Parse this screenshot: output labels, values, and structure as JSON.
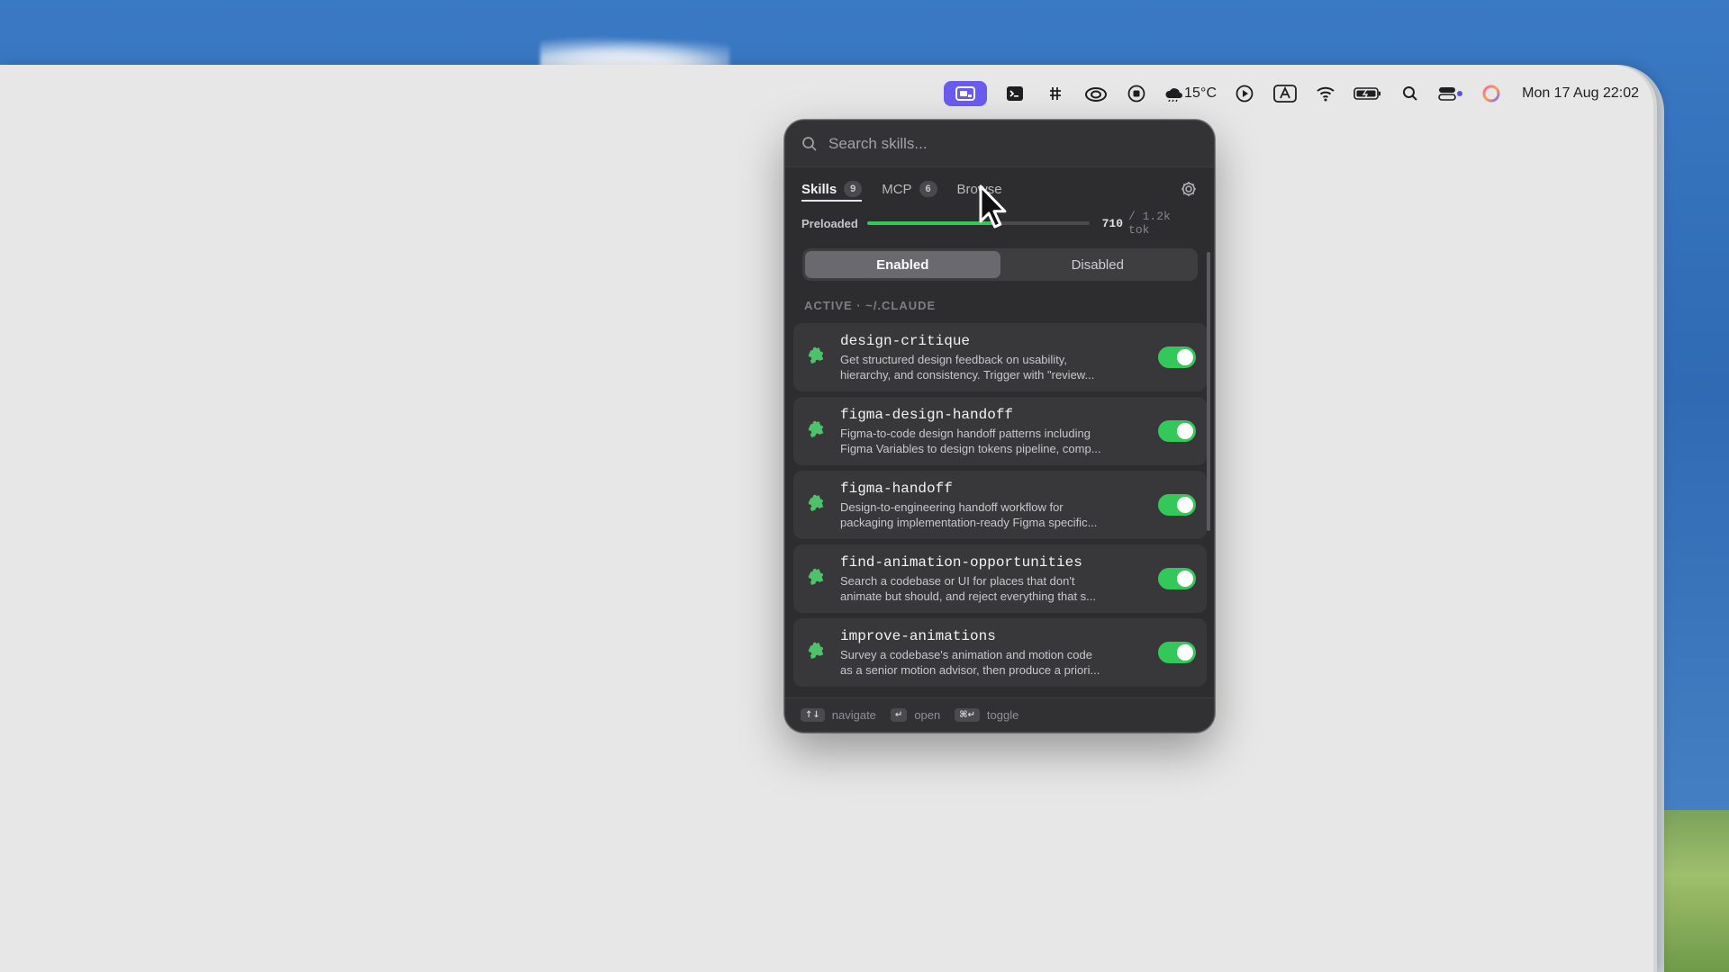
{
  "menubar": {
    "weather": "15°C",
    "clock": "Mon 17 Aug  22:02"
  },
  "popover": {
    "search": {
      "placeholder": "Search skills..."
    },
    "tabs": [
      {
        "label": "Skills",
        "badge": "9"
      },
      {
        "label": "MCP",
        "badge": "6"
      },
      {
        "label": "Browse"
      }
    ],
    "preload": {
      "label": "Preloaded",
      "used": "710",
      "total": "/ 1.2k tok",
      "fraction": 0.59
    },
    "segment": {
      "enabled": "Enabled",
      "disabled": "Disabled"
    },
    "section_title": "ACTIVE · ~/.CLAUDE",
    "skills": [
      {
        "name": "design-critique",
        "desc1": "Get structured design feedback on usability,",
        "desc2": "hierarchy, and consistency. Trigger with \"review..."
      },
      {
        "name": "figma-design-handoff",
        "desc1": "Figma-to-code design handoff patterns including",
        "desc2": "Figma Variables to design tokens pipeline, comp..."
      },
      {
        "name": "figma-handoff",
        "desc1": "Design-to-engineering handoff workflow for",
        "desc2": "packaging implementation-ready Figma specific..."
      },
      {
        "name": "find-animation-opportunities",
        "desc1": "Search a codebase or UI for places that don't",
        "desc2": "animate but should, and reject everything that s..."
      },
      {
        "name": "improve-animations",
        "desc1": "Survey a codebase's animation and motion code",
        "desc2": "as a senior motion advisor, then produce a priori..."
      }
    ],
    "footer": {
      "nav_key": "↑↓",
      "nav_label": "navigate",
      "open_key": "↵",
      "open_label": "open",
      "toggle_key": "⌘↵",
      "toggle_label": "toggle"
    }
  }
}
